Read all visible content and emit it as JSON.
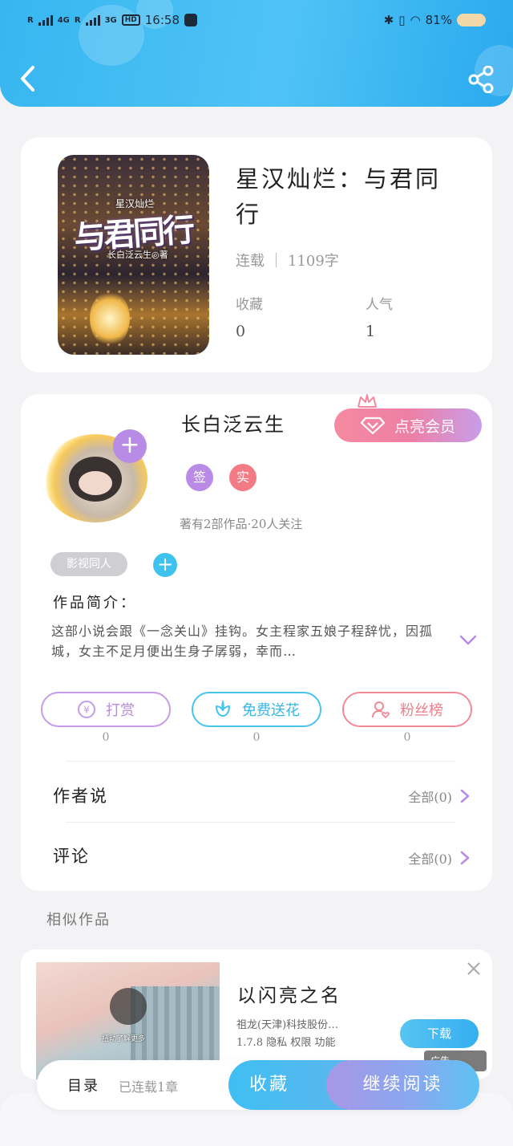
{
  "status_bar": {
    "sim1": "4G",
    "sim1_prefix": "R",
    "sim2": "3G",
    "sim2_prefix": "R",
    "hd": "HD",
    "time": "16:58",
    "battery": "81%"
  },
  "book": {
    "title": "星汉灿烂：与君同行",
    "status": "连载",
    "word_count": "1109字",
    "favorites_label": "收藏",
    "favorites_value": "0",
    "popularity_label": "人气",
    "popularity_value": "1",
    "cover_small_title": "星汉灿烂",
    "cover_big_title": "与君同行",
    "cover_author": "长白泛云生◎著"
  },
  "author": {
    "name": "长白泛云生",
    "vip_button": "点亮会员",
    "badge_sign": "签",
    "badge_real": "实",
    "info": "著有2部作品·20人关注",
    "tag": "影视同人",
    "intro_label": "作品简介：",
    "intro_text": "这部小说会跟《一念关山》挂钩。女主程家五娘子程辞忧，因孤城，女主不足月便出生身子孱弱，幸而…",
    "colors": {
      "sign": "#b98ae6",
      "real": "#f27b86",
      "accent_blue": "#40c2ee",
      "accent_purple": "#b78be6"
    }
  },
  "actions": [
    {
      "label": "打赏",
      "count": "0",
      "color": "#c69be9"
    },
    {
      "label": "免费送花",
      "count": "0",
      "color": "#45c5ee"
    },
    {
      "label": "粉丝榜",
      "count": "0",
      "color": "#f08a96"
    }
  ],
  "author_says": {
    "label": "作者说",
    "link": "全部(0)"
  },
  "comments": {
    "label": "评论",
    "link": "全部(0)"
  },
  "similar": {
    "title": "相似作品",
    "ad": {
      "title": "以闪亮之名",
      "desc1": "祖龙(天津)科技股份…",
      "desc2": "1.7.8  隐私  权限  功能",
      "download": "下载",
      "badge": "广告",
      "hint": "扭动了解更多"
    }
  },
  "bottom_bar": {
    "toc": "目录",
    "toc_status": "已连载1章",
    "favorite": "收藏",
    "continue": "继续阅读"
  }
}
